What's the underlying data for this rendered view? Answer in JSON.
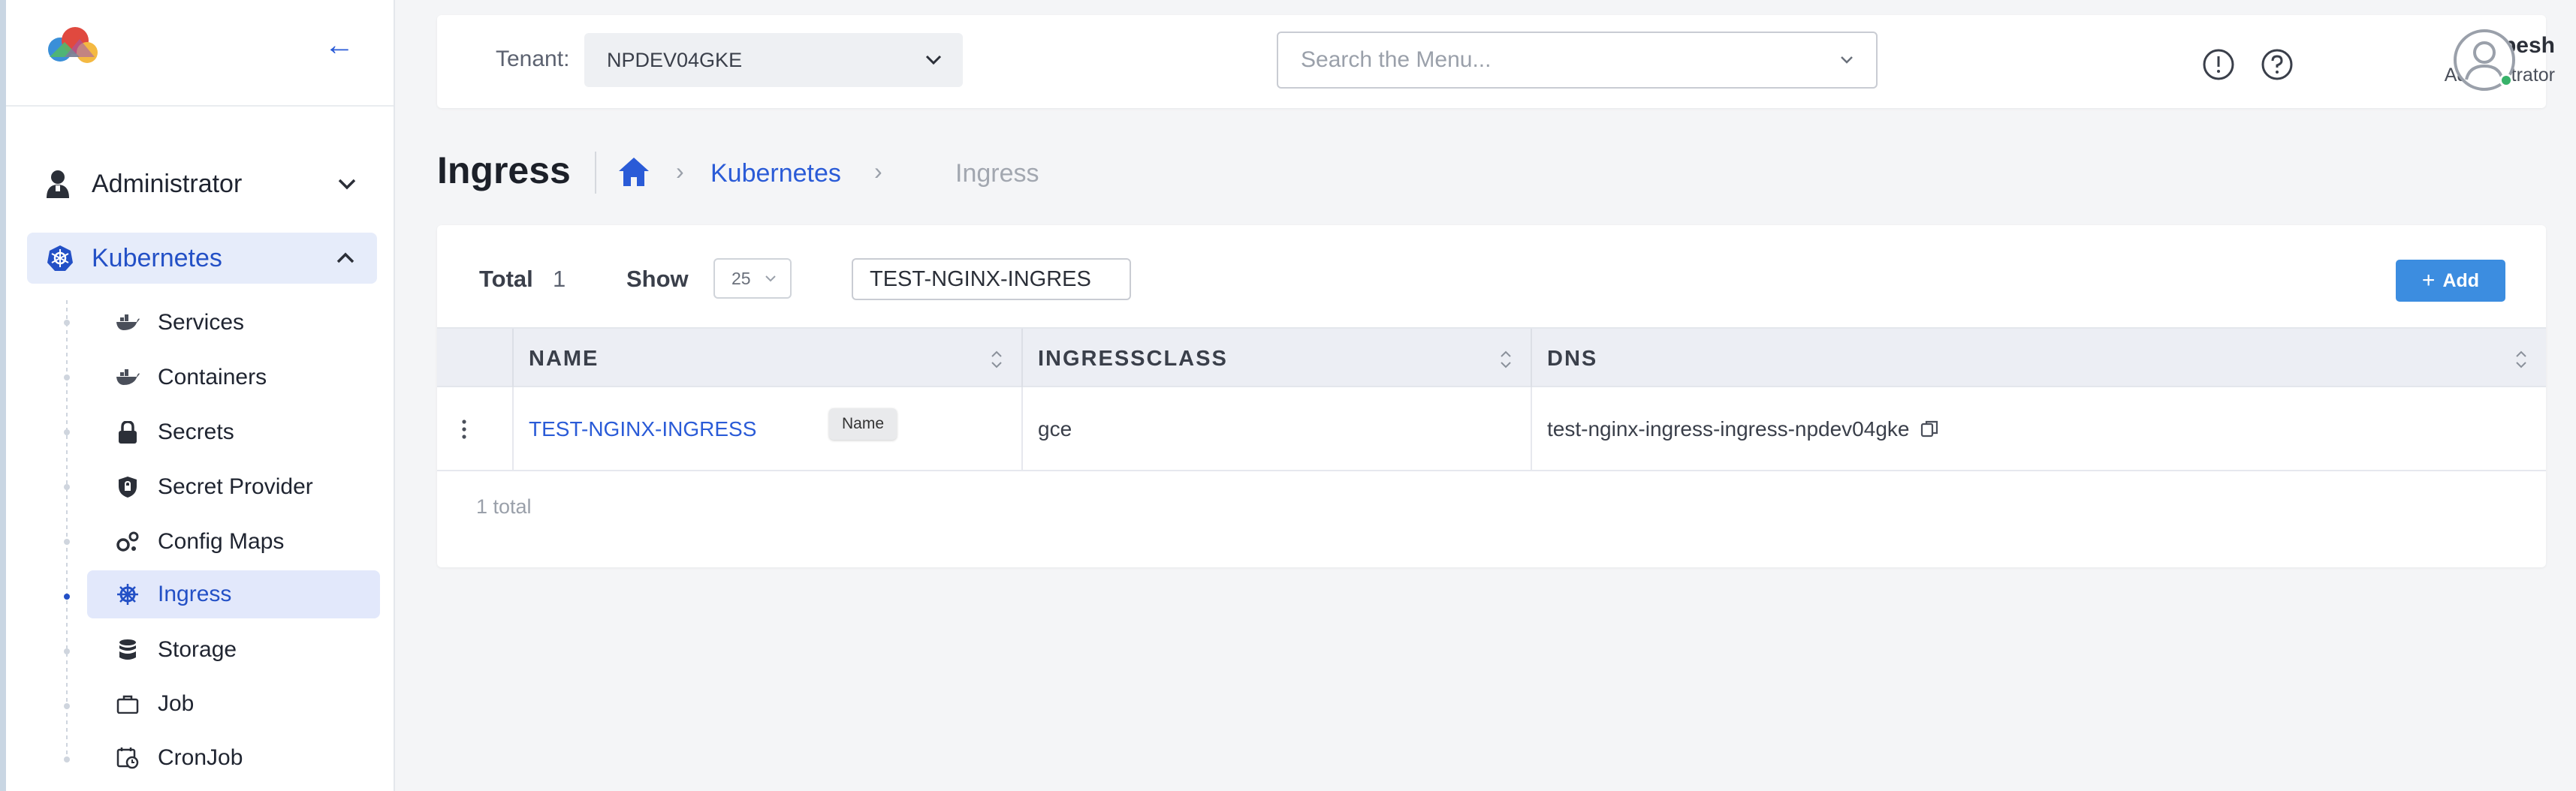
{
  "sidebar": {
    "admin_label": "Administrator",
    "kubernetes_label": "Kubernetes",
    "items": [
      {
        "label": "Services",
        "icon": "docker-whale-icon"
      },
      {
        "label": "Containers",
        "icon": "docker-whale-icon"
      },
      {
        "label": "Secrets",
        "icon": "lock-icon"
      },
      {
        "label": "Secret Provider",
        "icon": "shield-icon"
      },
      {
        "label": "Config Maps",
        "icon": "gears-icon"
      },
      {
        "label": "Ingress",
        "icon": "helm-wheel-icon",
        "active": true
      },
      {
        "label": "Storage",
        "icon": "database-icon"
      },
      {
        "label": "Job",
        "icon": "briefcase-icon"
      },
      {
        "label": "CronJob",
        "icon": "calendar-clock-icon"
      }
    ]
  },
  "header": {
    "tenant_label": "Tenant:",
    "tenant_value": "NPDEV04GKE",
    "search_placeholder": "Search the Menu...",
    "user_name": "Kalpesh",
    "user_role": "Administrator"
  },
  "page": {
    "title": "Ingress",
    "breadcrumb": [
      "Kubernetes",
      "Ingress"
    ]
  },
  "table_toolbar": {
    "total_label": "Total",
    "total_value": "1",
    "show_label": "Show",
    "page_size": "25",
    "filter_value": "TEST-NGINX-INGRES",
    "add_label": "Add"
  },
  "table": {
    "columns": [
      "NAME",
      "INGRESSCLASS",
      "DNS"
    ],
    "rows": [
      {
        "name": "TEST-NGINX-INGRESS",
        "ingressclass": "gce",
        "dns": "test-nginx-ingress-ingress-npdev04gke"
      }
    ],
    "tooltip": "Name",
    "footer": "1 total"
  },
  "colors": {
    "accent": "#2a5bd7",
    "add_button": "#3c8de0",
    "active_bg": "#e2e8fb",
    "status_online": "#38b26a"
  }
}
